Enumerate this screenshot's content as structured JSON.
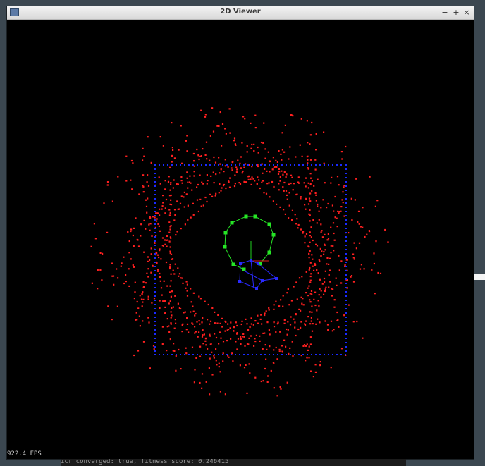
{
  "window": {
    "title": "2D Viewer",
    "controls": {
      "minimize": "−",
      "maximize": "+",
      "close": "×"
    }
  },
  "viewer": {
    "fps_label": "922.4 FPS",
    "background_color": "#000000",
    "point_cloud_color": "#ff2020",
    "bounding_box_color": "#1a2bff",
    "path_color": "#26e626",
    "robot_color": "#2a2aff"
  },
  "console": {
    "partial_line": "icr converged: true, fitness score: 0.246415"
  }
}
